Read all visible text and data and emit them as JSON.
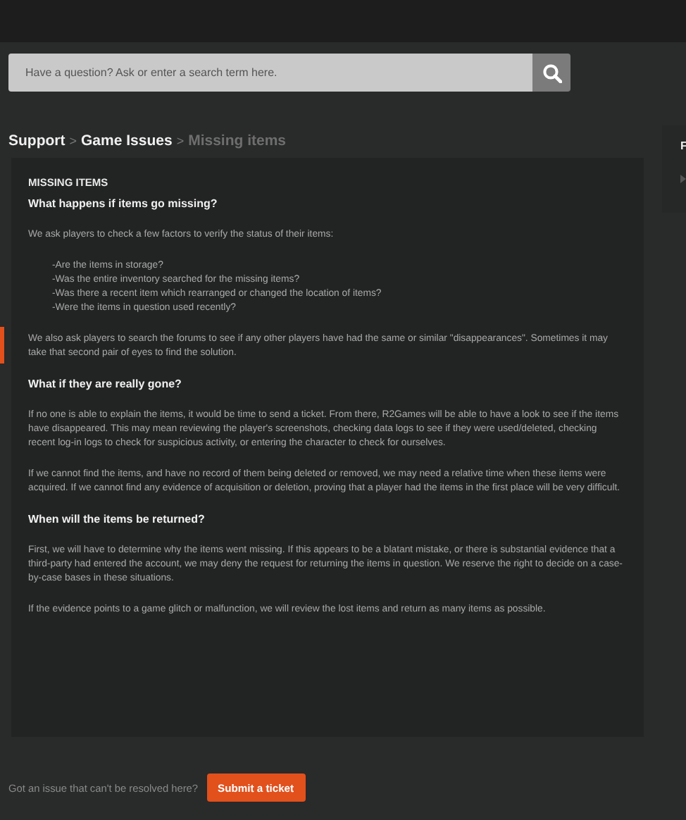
{
  "search": {
    "placeholder": "Have a question? Ask or enter a search term here."
  },
  "breadcrumb": [
    {
      "label": "Support",
      "current": false
    },
    {
      "label": "Game Issues",
      "current": false
    },
    {
      "label": "Missing items",
      "current": true
    }
  ],
  "breadcrumb_separator": ">",
  "article": [
    {
      "kind": "title",
      "text": "MISSING ITEMS"
    },
    {
      "kind": "heading",
      "text": "What happens if items go missing?"
    },
    {
      "kind": "paragraph",
      "text": "We ask players to check a few factors to verify the status of their items:"
    },
    {
      "kind": "list",
      "items": [
        "-Are the items in storage?",
        "-Was the entire inventory searched for the missing items?",
        "-Was there a recent item which rearranged or changed the location of items?",
        "-Were the items in question used recently?"
      ]
    },
    {
      "kind": "paragraph",
      "text": "We also ask players to search the forums to see if any other players have had the same or similar \"disappearances\". Sometimes it may take that second pair of eyes to find the solution."
    },
    {
      "kind": "heading",
      "text": "What if they are really gone?"
    },
    {
      "kind": "paragraph",
      "text": "If no one is able to explain the items, it would be time to send a ticket. From there, R2Games will be able to have a look to see if the items have disappeared. This may mean reviewing the player's screenshots, checking data logs to see if they were used/deleted, checking recent log-in logs to check for suspicious activity, or entering the character to check for ourselves."
    },
    {
      "kind": "paragraph",
      "text": "If we cannot find the items, and have no record of them being deleted or removed, we may need a relative time when these items were acquired. If we cannot find any evidence of acquisition or deletion, proving that a player had the items in the first place will be very difficult."
    },
    {
      "kind": "heading",
      "text": "When will the items be returned?"
    },
    {
      "kind": "paragraph",
      "text": "First, we will have to determine why the items went missing. If this appears to be a blatant mistake, or there is substantial evidence that a third-party had entered the account, we may deny the request for returning the items in question. We reserve the right to decide on a case-by-case bases in these situations."
    },
    {
      "kind": "paragraph",
      "text": "If the evidence points to a game glitch or malfunction, we will review the lost items and return as many items as possible."
    }
  ],
  "side_panel": {
    "title": "F"
  },
  "footer": {
    "prompt": "Got an issue that can't be resolved here?",
    "button": "Submit a ticket"
  }
}
